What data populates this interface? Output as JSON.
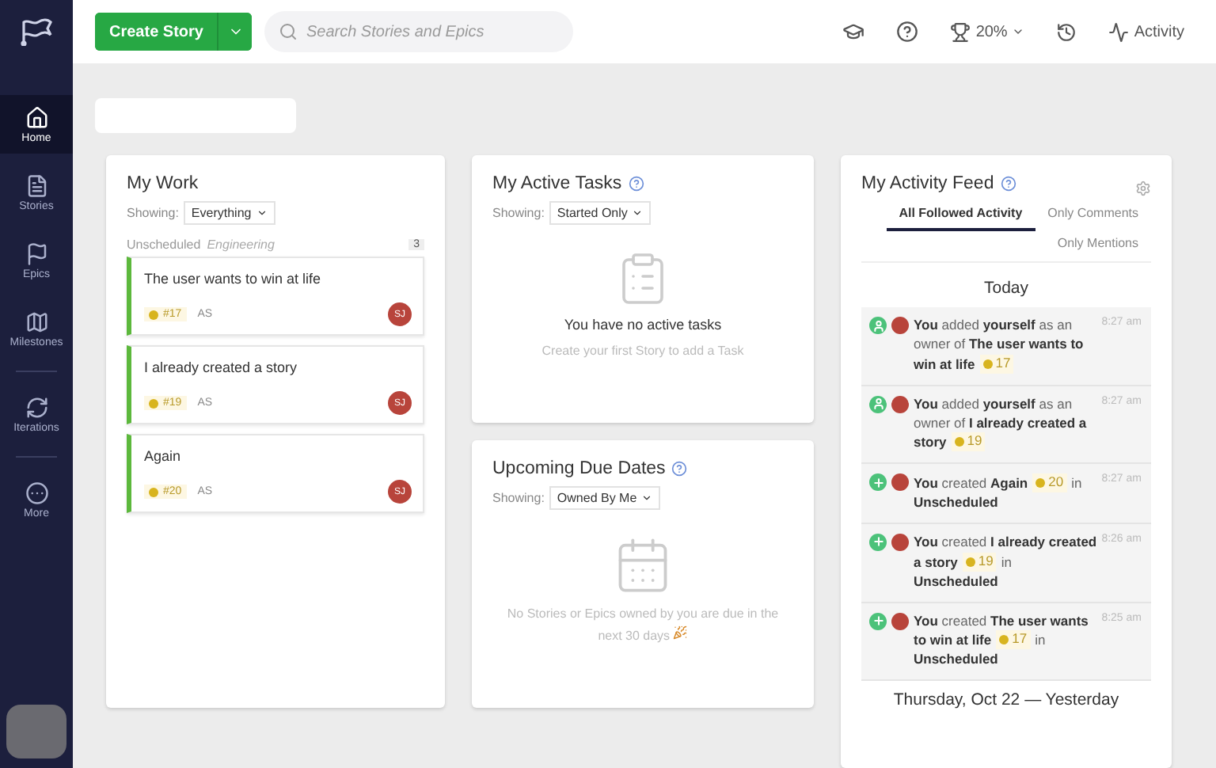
{
  "sidebar": {
    "items": [
      {
        "label": "Home",
        "selected": true
      },
      {
        "label": "Stories",
        "selected": false
      },
      {
        "label": "Epics",
        "selected": false
      },
      {
        "label": "Milestones",
        "selected": false
      },
      {
        "label": "Iterations",
        "selected": false
      },
      {
        "label": "More",
        "selected": false
      }
    ]
  },
  "topbar": {
    "create_button": "Create Story",
    "search": {
      "placeholder": "Search Stories and Epics"
    },
    "progress": "20%",
    "activity": "Activity"
  },
  "my_work": {
    "title": "My Work",
    "showing_label": "Showing:",
    "filter": "Everything",
    "group": {
      "name": "Unscheduled",
      "team": "Engineering",
      "count": "3"
    },
    "stories": [
      {
        "title": "The user wants to win at life",
        "id": "#17",
        "estimate": "AS",
        "owner": "SJ"
      },
      {
        "title": "I already created a story",
        "id": "#19",
        "estimate": "AS",
        "owner": "SJ"
      },
      {
        "title": "Again",
        "id": "#20",
        "estimate": "AS",
        "owner": "SJ"
      }
    ]
  },
  "active_tasks": {
    "title": "My Active Tasks",
    "showing_label": "Showing:",
    "filter": "Started Only",
    "empty_title": "You have no active tasks",
    "empty_hint": "Create your first Story to add a Task"
  },
  "due_dates": {
    "title": "Upcoming Due Dates",
    "showing_label": "Showing:",
    "filter": "Owned By Me",
    "empty_hint": "No Stories or Epics owned by you are due in the next 30 days"
  },
  "feed": {
    "title": "My Activity Feed",
    "tabs": [
      {
        "label": "All Followed Activity",
        "selected": true
      },
      {
        "label": "Only Comments",
        "selected": false
      },
      {
        "label": "Only Mentions",
        "selected": false
      }
    ],
    "sections": [
      {
        "heading": "Today",
        "entries": [
          {
            "kind": "owner",
            "text": "**You** added **yourself** as an owner of **The user wants to win at life**",
            "story_id": "17",
            "time": "8:27 am"
          },
          {
            "kind": "owner",
            "text": "**You** added **yourself** as an owner of **I already created a story**",
            "story_id": "19",
            "time": "8:27 am"
          },
          {
            "kind": "created",
            "text": "**You** created **Again**",
            "story_id": "20",
            "after": "in **Unscheduled**",
            "time": "8:27 am"
          },
          {
            "kind": "created",
            "text": "**You** created **I already created a story**",
            "story_id": "19",
            "after": "in **Unscheduled**",
            "time": "8:26 am"
          },
          {
            "kind": "created",
            "text": "**You** created **The user wants to win at life**",
            "story_id": "17",
            "after": "in **Unscheduled**",
            "time": "8:25 am"
          }
        ]
      },
      {
        "heading": "Thursday, Oct 22 — Yesterday"
      }
    ]
  }
}
